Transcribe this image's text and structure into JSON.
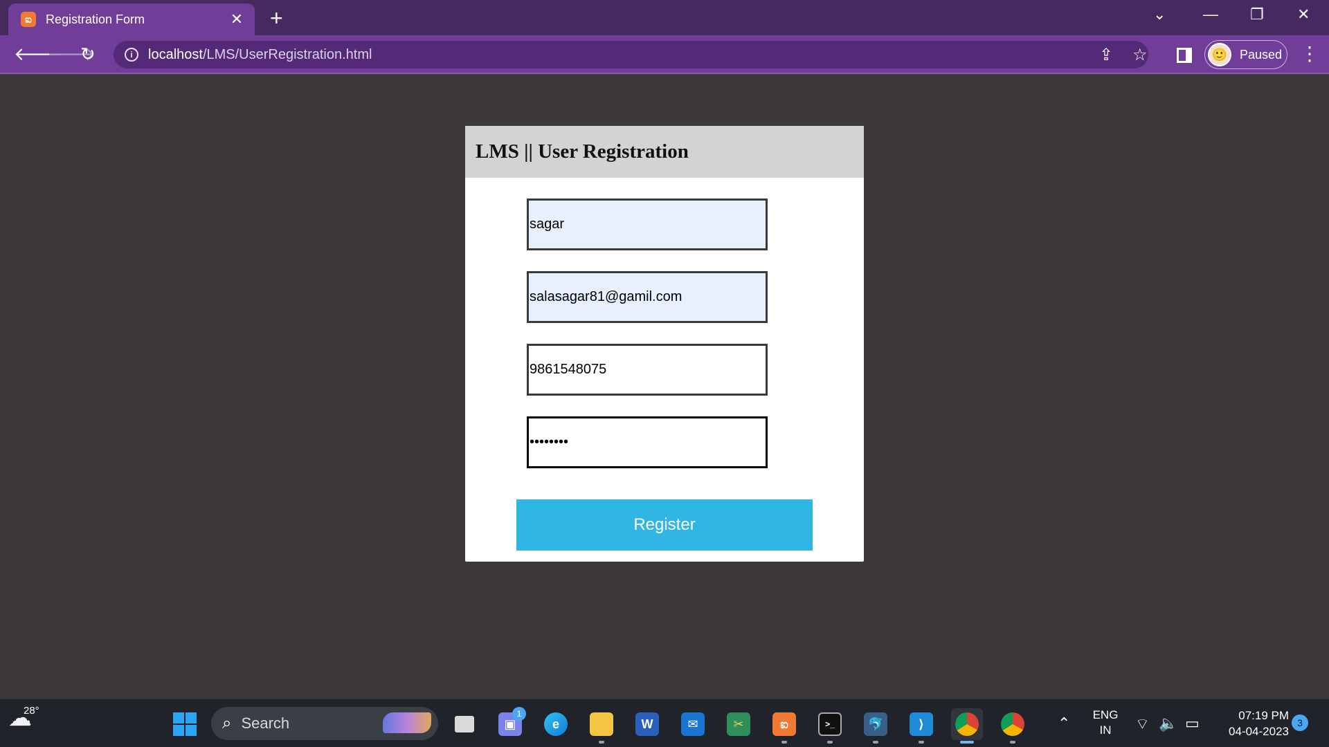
{
  "browser": {
    "tab_title": "Registration Form",
    "tab_close": "✕",
    "new_tab": "+",
    "url_host": "localhost",
    "url_path": "/LMS/UserRegistration.html",
    "profile_label": "Paused",
    "window_controls": {
      "minimize": "—",
      "restore": "❐",
      "close": "✕",
      "tab_search": "⌄"
    }
  },
  "page": {
    "title": "LMS || User Registration",
    "fields": {
      "name": "sagar",
      "email": "salasagar81@gamil.com",
      "phone": "9861548075",
      "password": "••••••••"
    },
    "register_label": "Register"
  },
  "taskbar": {
    "weather_temp": "28°",
    "search_label": "Search",
    "teams_badge": "1",
    "tray": {
      "language_top": "ENG",
      "language_bottom": "IN",
      "time": "07:19 PM",
      "date": "04-04-2023",
      "notification_count": "3"
    }
  },
  "colors": {
    "tab_strip": "#45295f",
    "toolbar": "#703d99",
    "page_bg": "#3d3939",
    "card_header": "#d3d3d3",
    "autofill_bg": "#e8f0fe",
    "register_button": "#31b5e5",
    "taskbar": "#202329"
  },
  "icons": [
    "xampp-favicon",
    "back-arrow-icon",
    "forward-arrow-icon",
    "reload-icon",
    "info-icon",
    "share-icon",
    "star-icon",
    "side-panel-icon",
    "kebab-menu-icon",
    "windows-start-icon",
    "search-icon",
    "edge-icon",
    "file-explorer-icon",
    "word-icon",
    "mail-icon",
    "xampp-icon",
    "terminal-icon",
    "vscode-icon",
    "chrome-icon",
    "wifi-icon",
    "speaker-icon",
    "battery-icon"
  ]
}
